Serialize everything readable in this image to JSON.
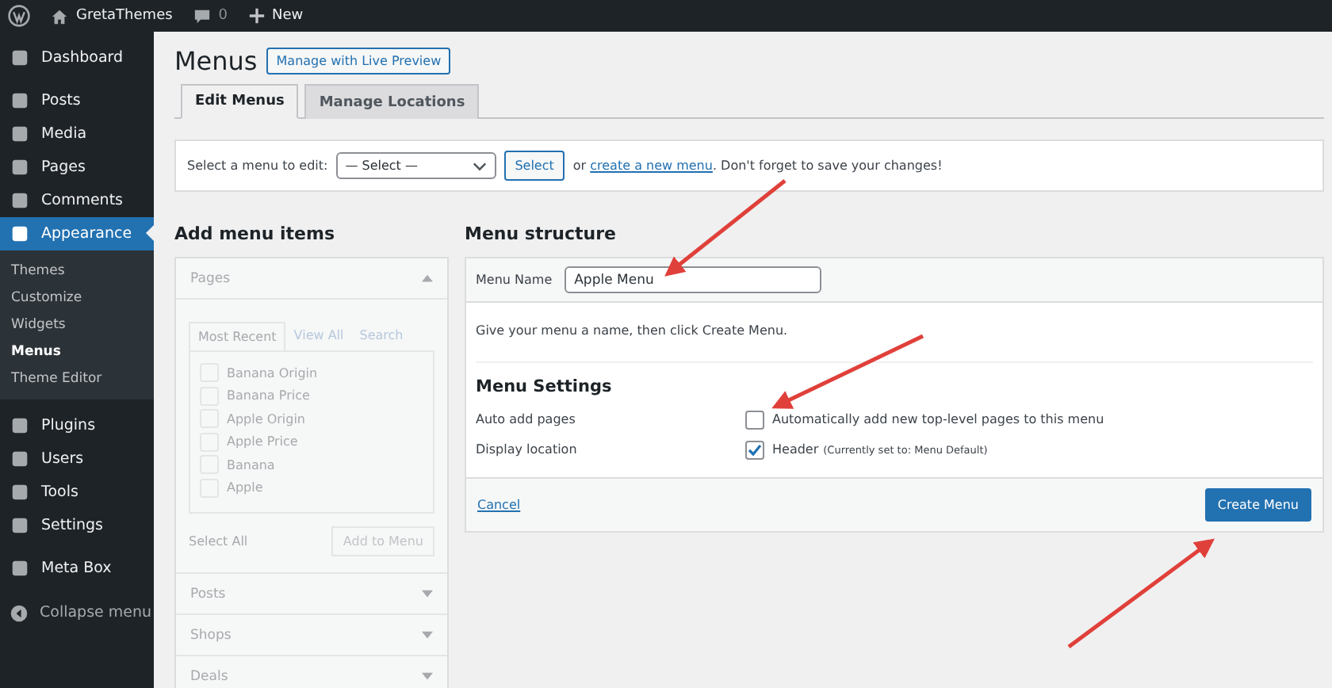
{
  "admin_bar": {
    "site": "GretaThemes",
    "comments": "0",
    "new": "New"
  },
  "sidebar": {
    "items": [
      {
        "label": "Dashboard",
        "selected": false
      },
      {
        "label": "Posts",
        "selected": false
      },
      {
        "label": "Media",
        "selected": false
      },
      {
        "label": "Pages",
        "selected": false
      },
      {
        "label": "Comments",
        "selected": false
      },
      {
        "label": "Appearance",
        "selected": true,
        "children": [
          {
            "label": "Themes",
            "selected": false
          },
          {
            "label": "Customize",
            "selected": false
          },
          {
            "label": "Widgets",
            "selected": false
          },
          {
            "label": "Menus",
            "selected": true
          },
          {
            "label": "Theme Editor",
            "selected": false
          }
        ]
      },
      {
        "label": "Plugins",
        "selected": false
      },
      {
        "label": "Users",
        "selected": false
      },
      {
        "label": "Tools",
        "selected": false
      },
      {
        "label": "Settings",
        "selected": false
      },
      {
        "label": "Meta Box",
        "selected": false
      }
    ],
    "collapse": "Collapse menu"
  },
  "page": {
    "title": "Menus",
    "live_preview": "Manage with Live Preview"
  },
  "tabs": [
    {
      "label": "Edit Menus",
      "selected": true
    },
    {
      "label": "Manage Locations",
      "selected": false
    }
  ],
  "select_bar": {
    "label": "Select a menu to edit:",
    "select_value": "— Select —",
    "button": "Select",
    "text_before": "or ",
    "link": "create a new menu",
    "text_after": ". Don't forget to save your changes!"
  },
  "add_items": {
    "title": "Add menu items",
    "disabled": true,
    "sections": [
      {
        "label": "Pages",
        "expanded": true
      },
      {
        "label": "Posts",
        "expanded": false
      },
      {
        "label": "Shops",
        "expanded": false
      },
      {
        "label": "Deals",
        "expanded": false
      }
    ],
    "subtabs": [
      {
        "label": "Most Recent",
        "selected": true
      },
      {
        "label": "View All",
        "selected": false
      },
      {
        "label": "Search",
        "selected": false
      }
    ],
    "pages": [
      {
        "label": "Banana Origin",
        "checked": false
      },
      {
        "label": "Banana Price",
        "checked": false
      },
      {
        "label": "Apple Origin",
        "checked": false
      },
      {
        "label": "Apple Price",
        "checked": false
      },
      {
        "label": "Banana",
        "checked": false
      },
      {
        "label": "Apple",
        "checked": false
      }
    ],
    "select_all": "Select All",
    "add_button": "Add to Menu"
  },
  "menu_structure": {
    "title": "Menu structure",
    "name_label": "Menu Name",
    "name_value": "Apple Menu",
    "hint": "Give your menu a name, then click Create Menu.",
    "settings_title": "Menu Settings",
    "settings": [
      {
        "label": "Auto add pages",
        "option": "Automatically add new top-level pages to this menu",
        "checked": false
      },
      {
        "label": "Display location",
        "option": "Header",
        "note": "(Currently set to: Menu Default)",
        "checked": true
      }
    ],
    "cancel": "Cancel",
    "create": "Create Menu"
  }
}
